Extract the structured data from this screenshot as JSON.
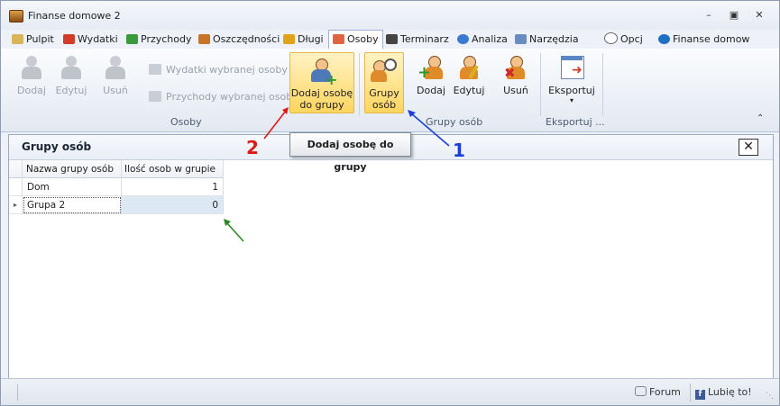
{
  "window": {
    "title": "Finanse domowe 2"
  },
  "tabs": [
    {
      "label": "Pulpit"
    },
    {
      "label": "Wydatki"
    },
    {
      "label": "Przychody"
    },
    {
      "label": "Oszczędności"
    },
    {
      "label": "Długi"
    },
    {
      "label": "Osoby"
    },
    {
      "label": "Terminarz"
    },
    {
      "label": "Analiza"
    },
    {
      "label": "Narzędzia"
    },
    {
      "label": "Opcj"
    },
    {
      "label": "Finanse domow"
    }
  ],
  "ribbon": {
    "osoby_group": {
      "label": "Osoby",
      "add": "Dodaj",
      "edit": "Edytuj",
      "delete": "Usuń",
      "expenses": "Wydatki wybranej osoby",
      "income": "Przychody wybranej osoby",
      "add_to_group_line1": "Dodaj osobę",
      "add_to_group_line2": "do grupy"
    },
    "groups_group": {
      "label": "Grupy osób",
      "groups_line1": "Grupy",
      "groups_line2": "osób",
      "add": "Dodaj",
      "edit": "Edytuj",
      "delete": "Usuń"
    },
    "export_group": {
      "label": "Eksportuj ...",
      "export": "Eksportuj"
    }
  },
  "tooltip": "Dodaj osobę do grupy",
  "annotations": {
    "one": "1",
    "two": "2"
  },
  "panel": {
    "title": "Grupy osób",
    "columns": [
      "Nazwa grupy osób",
      "Ilość osob w grupie"
    ],
    "rows": [
      {
        "name": "Dom",
        "count": "1"
      },
      {
        "name": "Grupa 2",
        "count": "0"
      }
    ]
  },
  "statusbar": {
    "forum": "Forum",
    "like": "Lubię to!"
  }
}
